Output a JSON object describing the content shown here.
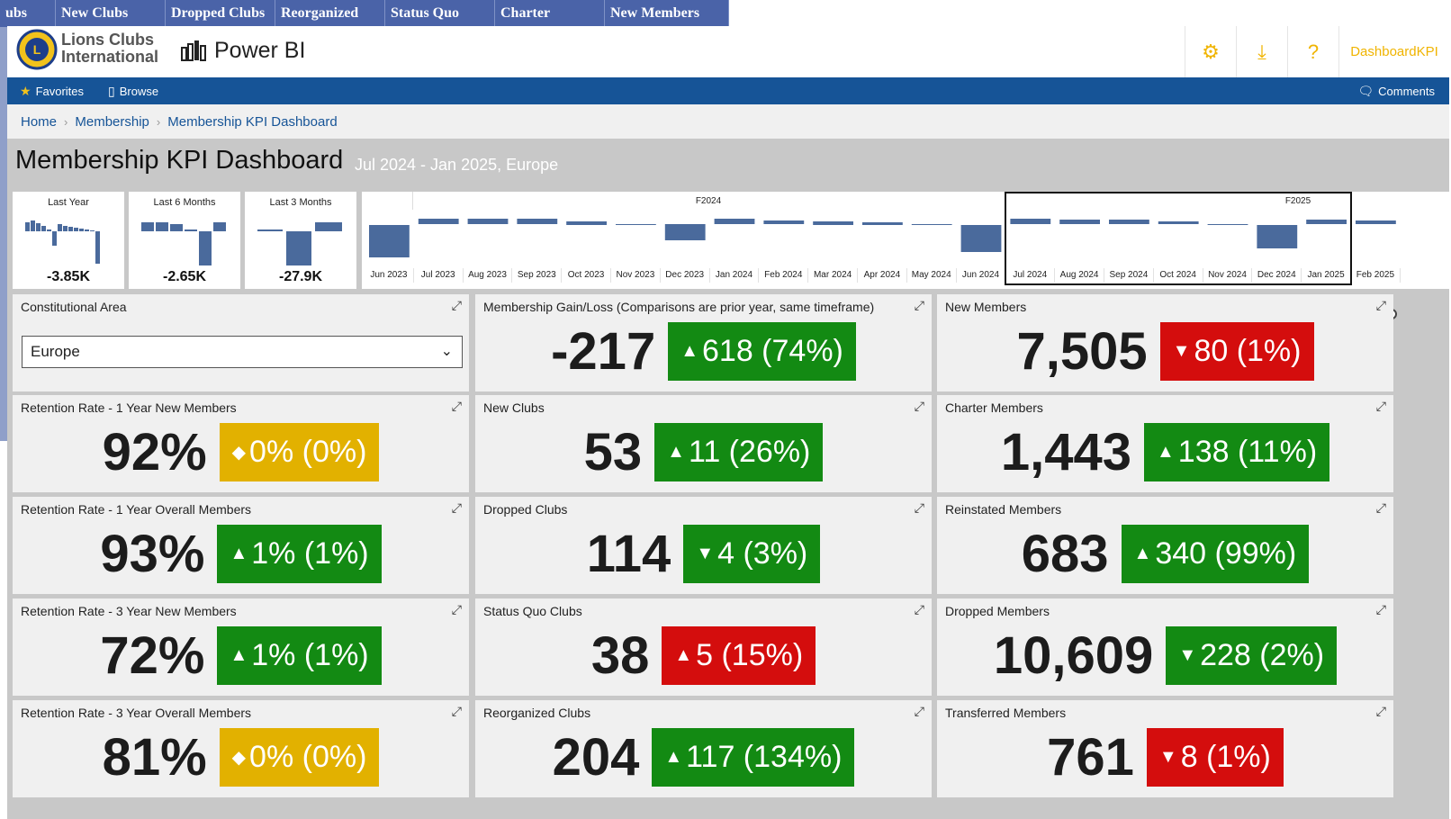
{
  "background_tabs": [
    "ubs",
    "New Clubs",
    "Dropped Clubs",
    "Reorganized",
    "Status Quo",
    "Charter",
    "New Members"
  ],
  "header": {
    "org_name_line1": "Lions Clubs",
    "org_name_line2": "International",
    "app_name": "Power BI",
    "user_label": "DashboardKPI",
    "icons": [
      "gear-icon",
      "download-icon",
      "help-icon"
    ]
  },
  "navbar": {
    "favorites": "Favorites",
    "browse": "Browse",
    "comments": "Comments"
  },
  "breadcrumb": {
    "home": "Home",
    "section": "Membership",
    "current": "Membership KPI Dashboard"
  },
  "report": {
    "title": "Membership KPI Dashboard",
    "subtitle": "Jul 2024 - Jan 2025, Europe"
  },
  "mini_charts": [
    {
      "title": "Last Year",
      "value": "-3.85K"
    },
    {
      "title": "Last 6 Months",
      "value": "-2.65K"
    },
    {
      "title": "Last 3 Months",
      "value": "-27.9K"
    }
  ],
  "timeline": {
    "fiscal_labels": [
      "F2024",
      "F2025"
    ],
    "months": [
      "Jun 2023",
      "Jul 2023",
      "Aug 2023",
      "Sep 2023",
      "Oct 2023",
      "Nov 2023",
      "Dec 2023",
      "Jan 2024",
      "Feb 2024",
      "Mar 2024",
      "Apr 2024",
      "May 2024",
      "Jun 2024",
      "Jul 2024",
      "Aug 2024",
      "Sep 2024",
      "Oct 2024",
      "Nov 2024",
      "Dec 2024",
      "Jan 2025",
      "Feb 2025"
    ],
    "selected_range": "Jul 2024 - Jan 2025"
  },
  "filter": {
    "label": "Constitutional Area",
    "selected": "Europe"
  },
  "cards": [
    {
      "title": "Membership Gain/Loss (Comparisons are prior year, same timeframe)",
      "value": "-217",
      "change": "618 (74%)",
      "direction": "up",
      "color": "#138a13"
    },
    {
      "title": "New Members",
      "value": "7,505",
      "change": "80 (1%)",
      "direction": "down",
      "color": "#d40d0d"
    },
    {
      "title": "Retention Rate - 1 Year New Members",
      "value": "92%",
      "change": "0% (0%)",
      "direction": "flat",
      "color": "#e2b100"
    },
    {
      "title": "New Clubs",
      "value": "53",
      "change": "11 (26%)",
      "direction": "up",
      "color": "#138a13"
    },
    {
      "title": "Charter Members",
      "value": "1,443",
      "change": "138 (11%)",
      "direction": "up",
      "color": "#138a13"
    },
    {
      "title": "Retention Rate - 1 Year Overall Members",
      "value": "93%",
      "change": "1% (1%)",
      "direction": "up",
      "color": "#138a13"
    },
    {
      "title": "Dropped Clubs",
      "value": "114",
      "change": "4 (3%)",
      "direction": "down",
      "color": "#138a13"
    },
    {
      "title": "Reinstated Members",
      "value": "683",
      "change": "340 (99%)",
      "direction": "up",
      "color": "#138a13"
    },
    {
      "title": "Retention Rate - 3 Year New Members",
      "value": "72%",
      "change": "1% (1%)",
      "direction": "up",
      "color": "#138a13"
    },
    {
      "title": "Status Quo Clubs",
      "value": "38",
      "change": "5 (15%)",
      "direction": "up",
      "color": "#d40d0d"
    },
    {
      "title": "Dropped Members",
      "value": "10,609",
      "change": "228 (2%)",
      "direction": "down",
      "color": "#138a13"
    },
    {
      "title": "Retention Rate - 3 Year Overall Members",
      "value": "81%",
      "change": "0% (0%)",
      "direction": "flat",
      "color": "#e2b100"
    },
    {
      "title": "Reorganized Clubs",
      "value": "204",
      "change": "117 (134%)",
      "direction": "up",
      "color": "#138a13"
    },
    {
      "title": "Transferred Members",
      "value": "761",
      "change": "8 (1%)",
      "direction": "down",
      "color": "#d40d0d"
    }
  ]
}
